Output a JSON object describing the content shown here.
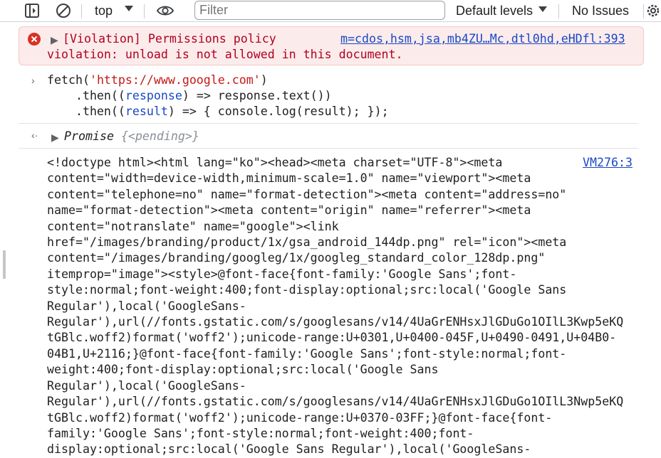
{
  "toolbar": {
    "context": "top",
    "filter_placeholder": "Filter",
    "levels_label": "Default levels",
    "issues_label": "No Issues"
  },
  "violation": {
    "line1": "[Violation] Permissions policy",
    "line2": "violation: unload is not allowed in this document.",
    "source": "m=cdos,hsm,jsa,mb4ZU…Mc,dtl0hd,eHDfl:393"
  },
  "input": {
    "l1_a": "fetch(",
    "l1_str": "'https://www.google.com'",
    "l1_b": ")",
    "l2_a": "    .then((",
    "l2_param": "response",
    "l2_b": ") => response.text())",
    "l3_a": "    .then((",
    "l3_param": "result",
    "l3_b": ") => { console.log(result); });"
  },
  "result": {
    "promise": "Promise",
    "pending": "{<pending>}"
  },
  "output": {
    "source": "VM276:3",
    "lines": [
      "<!doctype html><html lang=\"ko\"><head><meta charset=\"UTF-8\"><meta",
      "content=\"width=device-width,minimum-scale=1.0\" name=\"viewport\"><meta",
      "content=\"telephone=no\" name=\"format-detection\"><meta content=\"address=no\"",
      "name=\"format-detection\"><meta content=\"origin\" name=\"referrer\"><meta",
      "content=\"notranslate\" name=\"google\"><link",
      "href=\"/images/branding/product/1x/gsa_android_144dp.png\" rel=\"icon\"><meta",
      "content=\"/images/branding/googleg/1x/googleg_standard_color_128dp.png\"",
      "itemprop=\"image\"><style>@font-face{font-family:'Google Sans';font-",
      "style:normal;font-weight:400;font-display:optional;src:local('Google Sans",
      "Regular'),local('GoogleSans-",
      "Regular'),url(//fonts.gstatic.com/s/googlesans/v14/4UaGrENHsxJlGDuGo1OIlL3Kwp5eKQ",
      "tGBlc.woff2)format('woff2');unicode-range:U+0301,U+0400-045F,U+0490-0491,U+04B0-",
      "04B1,U+2116;}@font-face{font-family:'Google Sans';font-style:normal;font-",
      "weight:400;font-display:optional;src:local('Google Sans",
      "Regular'),local('GoogleSans-",
      "Regular'),url(//fonts.gstatic.com/s/googlesans/v14/4UaGrENHsxJlGDuGo1OIlL3Nwp5eKQ",
      "tGBlc.woff2)format('woff2');unicode-range:U+0370-03FF;}@font-face{font-",
      "family:'Google Sans';font-style:normal;font-weight:400;font-",
      "display:optional;src:local('Google Sans Regular'),local('GoogleSans-"
    ]
  }
}
